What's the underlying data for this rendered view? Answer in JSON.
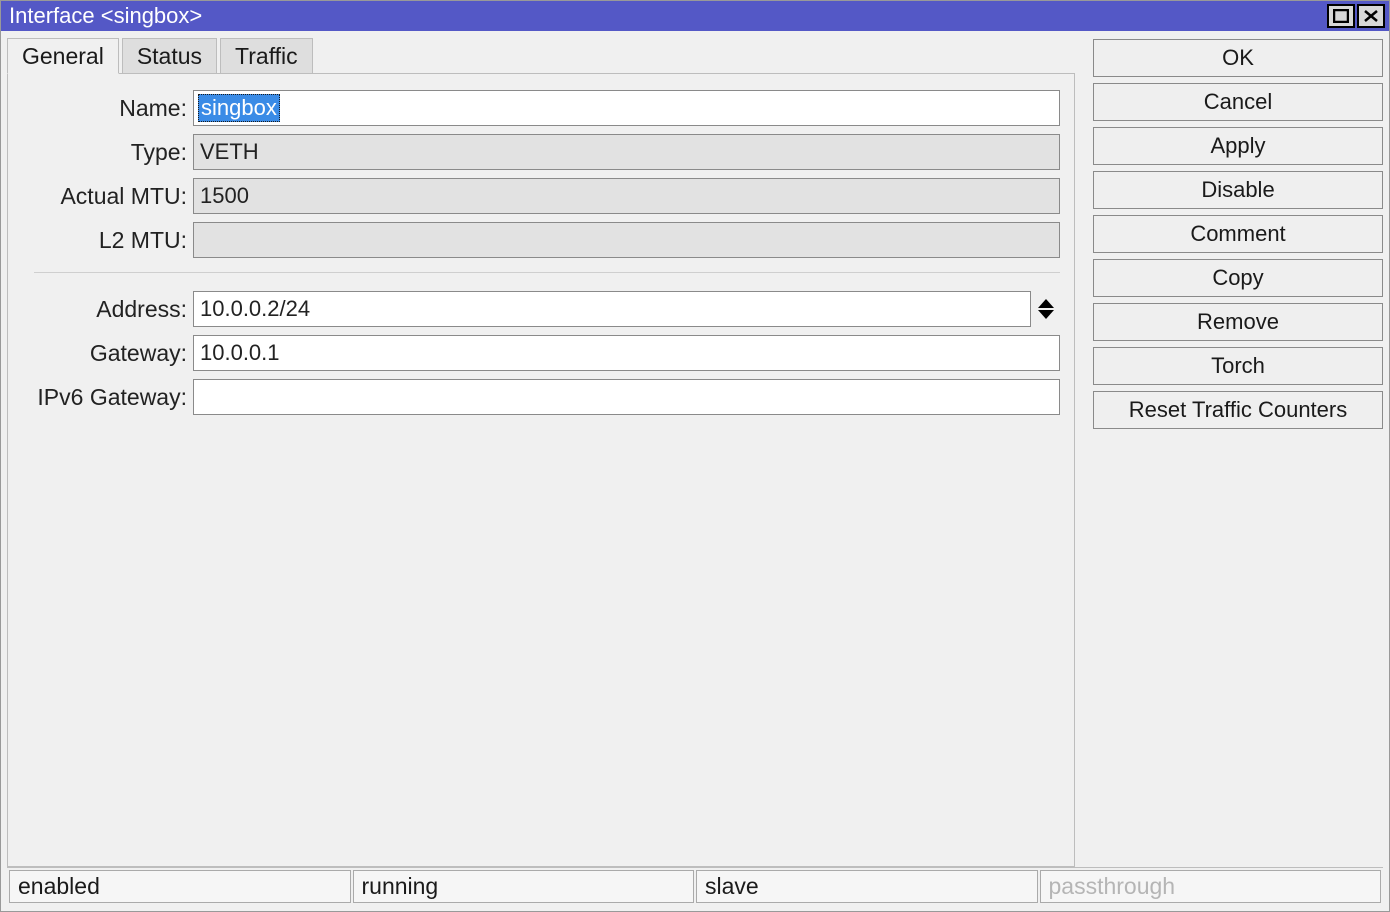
{
  "window": {
    "title": "Interface <singbox>"
  },
  "tabs": [
    {
      "label": "General"
    },
    {
      "label": "Status"
    },
    {
      "label": "Traffic"
    }
  ],
  "form": {
    "name_label": "Name:",
    "name_value": "singbox",
    "type_label": "Type:",
    "type_value": "VETH",
    "actual_mtu_label": "Actual MTU:",
    "actual_mtu_value": "1500",
    "l2_mtu_label": "L2 MTU:",
    "l2_mtu_value": "",
    "address_label": "Address:",
    "address_value": "10.0.0.2/24",
    "gateway_label": "Gateway:",
    "gateway_value": "10.0.0.1",
    "ipv6_gateway_label": "IPv6 Gateway:",
    "ipv6_gateway_value": ""
  },
  "buttons": {
    "ok": "OK",
    "cancel": "Cancel",
    "apply": "Apply",
    "disable": "Disable",
    "comment": "Comment",
    "copy": "Copy",
    "remove": "Remove",
    "torch": "Torch",
    "reset_traffic": "Reset Traffic Counters"
  },
  "status": {
    "cell1": "enabled",
    "cell2": "running",
    "cell3": "slave",
    "cell4": "passthrough"
  }
}
